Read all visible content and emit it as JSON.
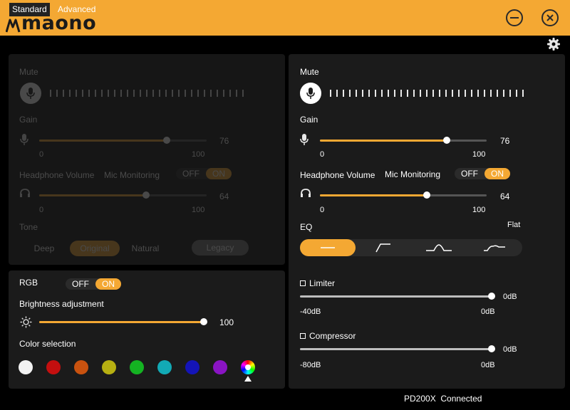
{
  "app": {
    "logo_text": "maono"
  },
  "modes": {
    "standard": "Standard",
    "advanced": "Advanced",
    "active": "Advanced"
  },
  "left_panel": {
    "mute_label": "Mute",
    "gain_label": "Gain",
    "gain_value": "76",
    "gain_min": "0",
    "gain_max": "100",
    "headphone_label": "Headphone Volume",
    "mic_monitoring_label": "Mic Monitoring",
    "mic_monitoring_off": "OFF",
    "mic_monitoring_on": "ON",
    "headphone_value": "64",
    "headphone_min": "0",
    "headphone_max": "100",
    "tone_label": "Tone",
    "tone_options": [
      "Deep",
      "Original",
      "Natural",
      "Legacy"
    ]
  },
  "rgb_panel": {
    "rgb_label": "RGB",
    "rgb_off": "OFF",
    "rgb_on": "ON",
    "brightness_label": "Brightness adjustment",
    "brightness_value": "100",
    "brightness_level": 1.0,
    "color_label": "Color selection",
    "colors": [
      "#f2f2f2",
      "#c40f0f",
      "#c9520f",
      "#b7b012",
      "#14b322",
      "#12aab5",
      "#1414b8",
      "#8a14c4",
      "rainbow"
    ],
    "selected_color_index": 8
  },
  "right_panel": {
    "mute_label": "Mute",
    "gain_label": "Gain",
    "gain_value": "76",
    "gain_min": "0",
    "gain_max": "100",
    "gain_level": 0.76,
    "headphone_label": "Headphone Volume",
    "mic_monitoring_label": "Mic Monitoring",
    "mic_monitoring_off": "OFF",
    "mic_monitoring_on": "ON",
    "headphone_value": "64",
    "headphone_min": "0",
    "headphone_max": "100",
    "headphone_level": 0.64,
    "eq_label": "EQ",
    "eq_mode": "Flat",
    "eq_presets": [
      "flat-icon",
      "low-cut-icon",
      "mid-boost-icon",
      "presence-icon"
    ],
    "limiter_label": "Limiter",
    "limiter_value": "0dB",
    "limiter_min": "-40dB",
    "limiter_max": "0dB",
    "compressor_label": "Compressor",
    "compressor_value": "0dB",
    "compressor_min": "-80dB",
    "compressor_max": "0dB"
  },
  "status": {
    "device": "PD200X",
    "state": "Connected"
  },
  "accent_color": "#f4a833"
}
